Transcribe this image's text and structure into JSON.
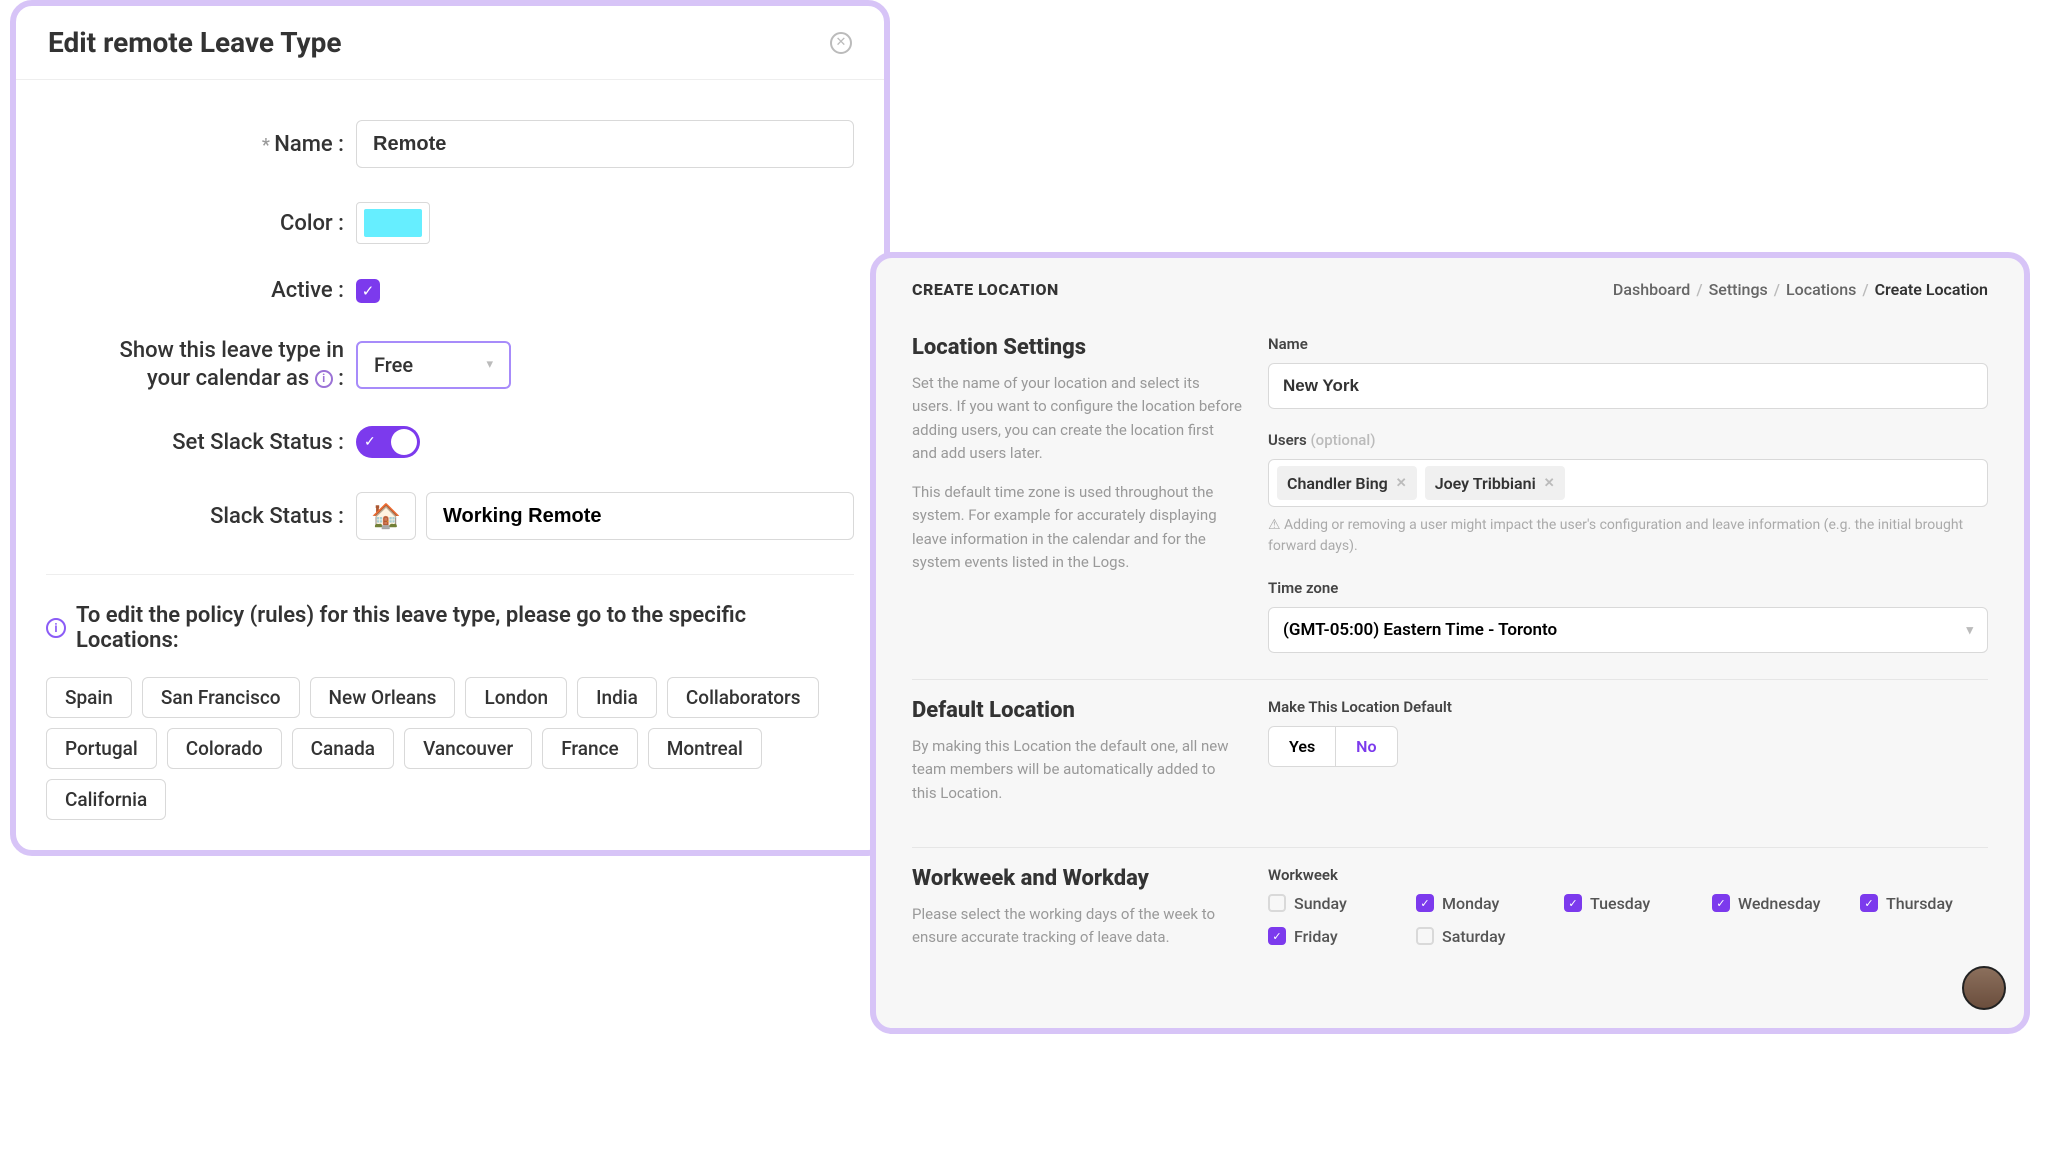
{
  "leave": {
    "title": "Edit remote Leave Type",
    "labels": {
      "name": "Name",
      "color": "Color",
      "active": "Active",
      "calendar1": "Show this leave type in",
      "calendar2": "your calendar as",
      "slack_toggle": "Set Slack Status",
      "slack_status": "Slack Status"
    },
    "name_value": "Remote",
    "color_value": "#66eeff",
    "calendar_select": "Free",
    "slack_emoji": "🏠",
    "slack_status_value": "Working Remote",
    "policy_note": "To edit the policy (rules) for this leave type, please go to the specific Locations:",
    "locations": [
      "Spain",
      "San Francisco",
      "New Orleans",
      "London",
      "India",
      "Collaborators",
      "Portugal",
      "Colorado",
      "Canada",
      "Vancouver",
      "France",
      "Montreal",
      "California"
    ]
  },
  "loc": {
    "heading": "CREATE LOCATION",
    "breadcrumb": [
      "Dashboard",
      "Settings",
      "Locations",
      "Create Location"
    ],
    "settings": {
      "title": "Location Settings",
      "desc1": "Set the name of your location and select its users. If you want to configure the location before adding users, you can create the location first and add users later.",
      "desc2": "This default time zone is used throughout the system. For example for accurately displaying leave information in the calendar and for the system events listed in the Logs.",
      "name_label": "Name",
      "name_value": "New York",
      "users_label": "Users",
      "users_optional": "(optional)",
      "users": [
        "Chandler Bing",
        "Joey Tribbiani"
      ],
      "users_hint": "⚠ Adding or removing a user might impact the user's configuration and leave information (e.g. the initial brought forward days).",
      "tz_label": "Time zone",
      "tz_value": "(GMT-05:00) Eastern Time - Toronto"
    },
    "default": {
      "title": "Default Location",
      "desc": "By making this Location the default one, all new team members will be automatically added to this Location.",
      "label": "Make This Location Default",
      "yes": "Yes",
      "no": "No"
    },
    "workweek": {
      "title": "Workweek and Workday",
      "desc": "Please select the working days of the week to ensure accurate tracking of leave data.",
      "label": "Workweek",
      "days": [
        {
          "name": "Sunday",
          "on": false
        },
        {
          "name": "Monday",
          "on": true
        },
        {
          "name": "Tuesday",
          "on": true
        },
        {
          "name": "Wednesday",
          "on": true
        },
        {
          "name": "Thursday",
          "on": true
        },
        {
          "name": "Friday",
          "on": true
        },
        {
          "name": "Saturday",
          "on": false
        }
      ]
    }
  }
}
